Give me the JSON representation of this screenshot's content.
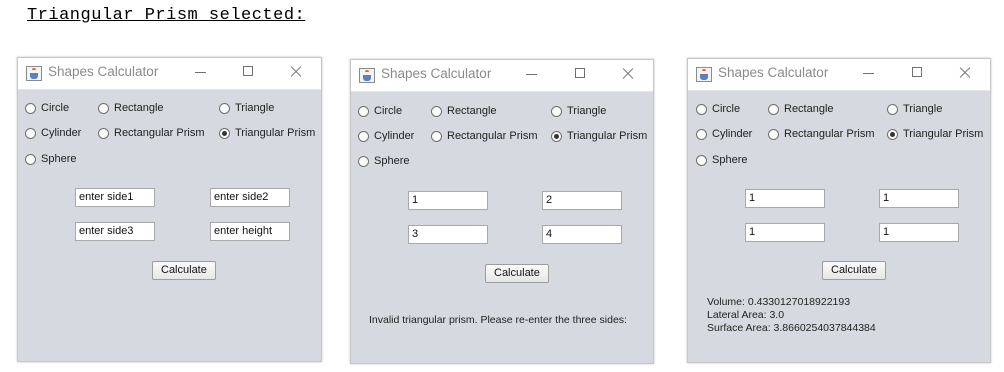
{
  "heading": "Triangular Prism selected:",
  "windows": [
    {
      "title": "Shapes Calculator",
      "shapes": {
        "circle": "Circle",
        "rectangle": "Rectangle",
        "triangle": "Triangle",
        "cylinder": "Cylinder",
        "rect_prism": "Rectangular Prism",
        "tri_prism": "Triangular Prism",
        "sphere": "Sphere"
      },
      "selected": "Triangular Prism",
      "fields": {
        "f1": "enter side1",
        "f2": "enter side2",
        "f3": "enter side3",
        "f4": "enter height"
      },
      "button": "Calculate",
      "message": ""
    },
    {
      "title": "Shapes Calculator",
      "shapes": {
        "circle": "Circle",
        "rectangle": "Rectangle",
        "triangle": "Triangle",
        "cylinder": "Cylinder",
        "rect_prism": "Rectangular Prism",
        "tri_prism": "Triangular Prism",
        "sphere": "Sphere"
      },
      "selected": "Triangular Prism",
      "fields": {
        "f1": "1",
        "f2": "2",
        "f3": "3",
        "f4": "4"
      },
      "button": "Calculate",
      "message": "Invalid triangular prism.  Please re-enter the three sides:"
    },
    {
      "title": "Shapes Calculator",
      "shapes": {
        "circle": "Circle",
        "rectangle": "Rectangle",
        "triangle": "Triangle",
        "cylinder": "Cylinder",
        "rect_prism": "Rectangular Prism",
        "tri_prism": "Triangular Prism",
        "sphere": "Sphere"
      },
      "selected": "Triangular Prism",
      "fields": {
        "f1": "1",
        "f2": "1",
        "f3": "1",
        "f4": "1"
      },
      "button": "Calculate",
      "results": {
        "volume": "Volume: 0.4330127018922193",
        "lateral": "Lateral Area: 3.0",
        "surface": "Surface Area: 3.8660254037844384"
      }
    }
  ]
}
